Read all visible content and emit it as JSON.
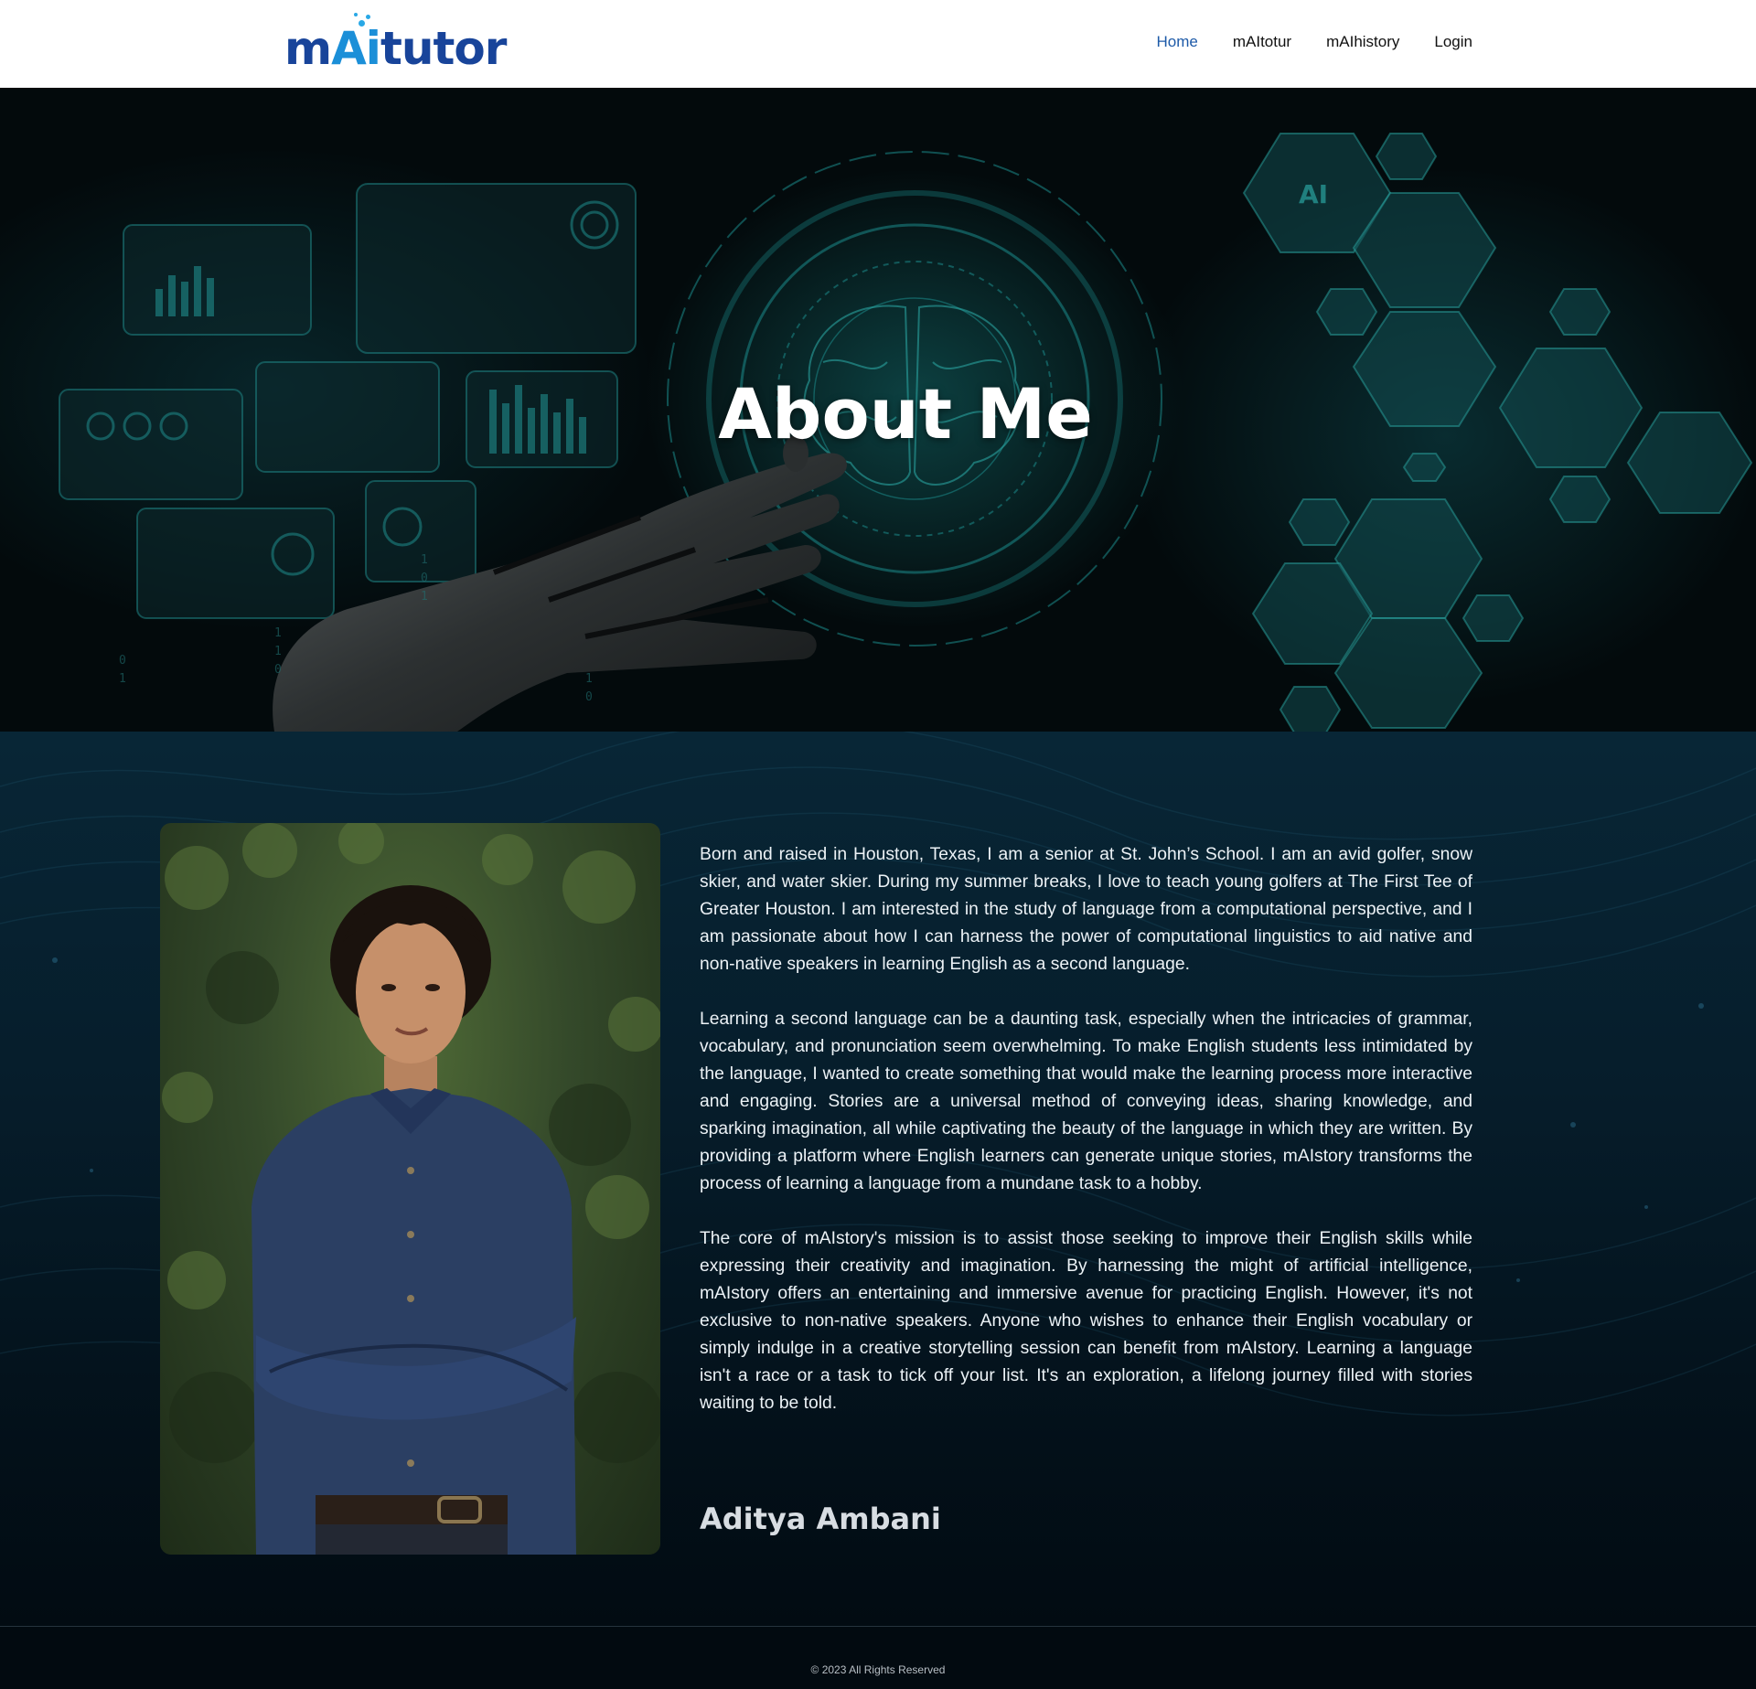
{
  "header": {
    "logo": {
      "part_m": "m",
      "part_ai": "Ai",
      "part_tutor": "tutor"
    },
    "nav": [
      {
        "label": "Home",
        "active": true
      },
      {
        "label": "mAItotur",
        "active": false
      },
      {
        "label": "mAIhistory",
        "active": false
      },
      {
        "label": "Login",
        "active": false
      }
    ]
  },
  "hero": {
    "title": "About Me"
  },
  "about": {
    "paragraphs": [
      "Born and raised in Houston, Texas, I am a senior at St. John’s School. I am an avid golfer, snow skier, and water skier. During my summer breaks, I love to teach young golfers at The First Tee of Greater Houston. I am interested in the study of language from a computational perspective, and I am passionate about how I can harness the power of computational linguistics to aid native and non-native speakers in learning English as a second language.",
      "Learning a second language can be a daunting task, especially when the intricacies of grammar, vocabulary, and pronunciation seem overwhelming. To make English students less intimidated by the language, I wanted to create something that would make the learning process more interactive and engaging. Stories are a universal method of conveying ideas, sharing knowledge, and sparking imagination, all while captivating the beauty of the language in which they are written. By providing a platform where English learners can generate unique stories, mAIstory transforms the process of learning a language from a mundane task to a hobby.",
      "The core of mAIstory's mission is to assist those seeking to improve their English skills while expressing their creativity and imagination. By harnessing the might of artificial intelligence, mAIstory offers an entertaining and immersive avenue for practicing English. However, it's not exclusive to non-native speakers. Anyone who wishes to enhance their English vocabulary or simply indulge in a creative storytelling session can benefit from mAIstory. Learning a language isn't a race or a task to tick off your list. It's an exploration, a lifelong journey filled with stories waiting to be told."
    ],
    "signature": "Aditya Ambani"
  },
  "footer": {
    "copyright": "© 2023 All Rights Reserved"
  },
  "colors": {
    "brand_dark_blue": "#18449a",
    "brand_light_blue": "#1b8fd8",
    "nav_active": "#1d5aa8",
    "hero_teal": "#137a7a",
    "section_bg": "#061d2b"
  }
}
